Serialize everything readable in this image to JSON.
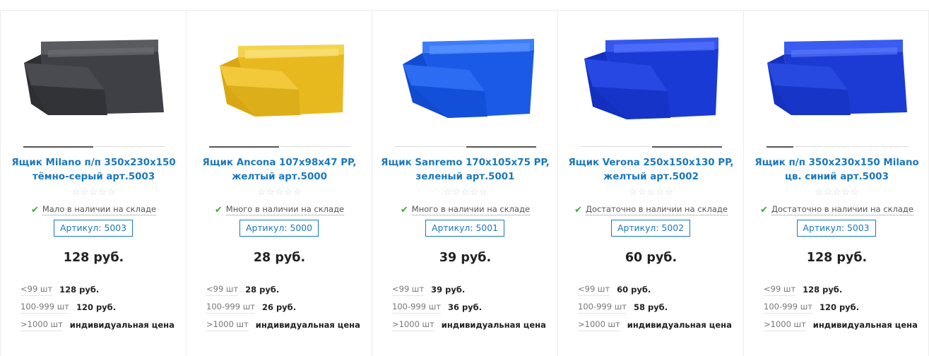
{
  "products": [
    {
      "title": "Ящик Milano п/п 350x230x150 тёмно-серый арт.5003",
      "stock": "Мало в наличии на складе",
      "sku": "Артикул: 5003",
      "price": "128 руб.",
      "color": "#3b3c40",
      "tiers": [
        {
          "qty": "<99 шт",
          "price": "128 руб."
        },
        {
          "qty": "100-999 шт",
          "price": "120 руб."
        },
        {
          "qty": ">1000 шт",
          "price": "индивидуальная цена"
        }
      ]
    },
    {
      "title": "Ящик Ancona 107x98x47 PP, желтый арт.5000",
      "stock": "Много в наличии на складе",
      "sku": "Артикул: 5000",
      "price": "28 руб.",
      "color": "#efc52e",
      "tiers": [
        {
          "qty": "<99 шт",
          "price": "28 руб."
        },
        {
          "qty": "100-999 шт",
          "price": "26 руб."
        },
        {
          "qty": ">1000 шт",
          "price": "индивидуальная цена"
        }
      ]
    },
    {
      "title": "Ящик Sanremo 170x105x75 PP, зеленый арт.5001",
      "stock": "Много в наличии на складе",
      "sku": "Артикул: 5001",
      "price": "39 руб.",
      "color": "#1d5fe8",
      "tiers": [
        {
          "qty": "<99 шт",
          "price": "39 руб."
        },
        {
          "qty": "100-999 шт",
          "price": "36 руб."
        },
        {
          "qty": ">1000 шт",
          "price": "индивидуальная цена"
        }
      ]
    },
    {
      "title": "Ящик Verona 250x150x130 PP, желтый арт.5002",
      "stock": "Достаточно в наличии на складе",
      "sku": "Артикул: 5002",
      "price": "60 руб.",
      "color": "#1a3fd6",
      "tiers": [
        {
          "qty": "<99 шт",
          "price": "60 руб."
        },
        {
          "qty": "100-999 шт",
          "price": "58 руб."
        },
        {
          "qty": ">1000 шт",
          "price": "индивидуальная цена"
        }
      ]
    },
    {
      "title": "Ящик п/п 350x230x150 Milano цв. синий арт.5003",
      "stock": "Достаточно в наличии на складе",
      "sku": "Артикул: 5003",
      "price": "128 руб.",
      "color": "#1d3fd4",
      "tiers": [
        {
          "qty": "<99 шт",
          "price": "128 руб."
        },
        {
          "qty": "100-999 шт",
          "price": "120 руб."
        },
        {
          "qty": ">1000 шт",
          "price": "индивидуальная цена"
        }
      ]
    }
  ],
  "stars": [
    "☆",
    "☆",
    "☆",
    "☆",
    "☆"
  ],
  "check_icon": "✔"
}
